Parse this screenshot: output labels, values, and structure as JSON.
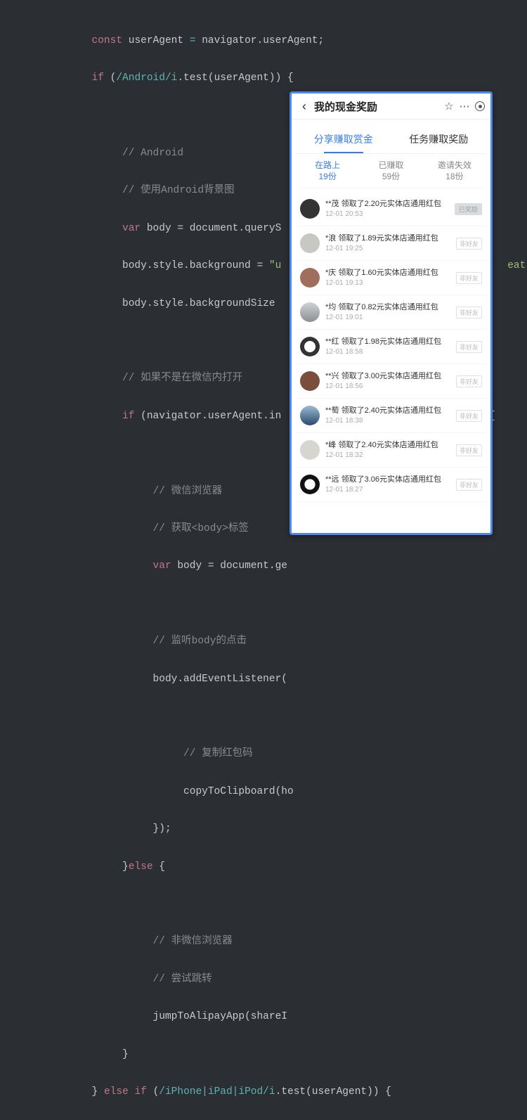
{
  "code": {
    "l1a": "const",
    "l1b": "userAgent",
    "l1c": "=",
    "l1d": "navigator",
    "l1e": ".userAgent;",
    "l2a": "if",
    "l2b": "(",
    "l2c": "/Android/i",
    "l2d": ".test(userAgent)) {",
    "l4": "// Android",
    "l5": "// 使用Android背景图",
    "l6a": "var",
    "l6b": "body = document.queryS",
    "l7a": "body.style.background = ",
    "l7b": "\"u",
    "l7c": "eat\"",
    "l7d": ";",
    "l8": "body.style.backgroundSize",
    "l10": "// 如果不是在微信内打开",
    "l11a": "if",
    "l11b": "(navigator.userAgent.in",
    "l11c": ") {",
    "l13": "// 微信浏览器",
    "l14": "// 获取<body>标签",
    "l15a": "var",
    "l15b": "body = document.ge",
    "l17": "// 监听body的点击",
    "l18": "body.addEventListener(",
    "l20": "// 复制红包码",
    "l21": "copyToClipboard(ho",
    "l22": "});",
    "l23a": "}",
    "l23b": "else",
    "l23c": "{",
    "l25": "// 非微信浏览器",
    "l26": "// 尝试跳转",
    "l27": "jumpToAlipayApp(shareI",
    "l28": "}",
    "l29a": "} ",
    "l29b": "else if",
    "l29c": "(",
    "l29d": "/iPhone|iPad|iPod/i",
    "l29e": ".test(userAgent)) {"
  },
  "phone": {
    "title": "我的现金奖励",
    "tabs": [
      "分享赚取赏金",
      "任务赚取奖励"
    ],
    "stats": [
      {
        "label": "在路上",
        "value": "19份"
      },
      {
        "label": "已赚取",
        "value": "59份"
      },
      {
        "label": "邀请失效",
        "value": "18份"
      }
    ],
    "rows": [
      {
        "name": "**茂 领取了2.20元实体店通用红包",
        "time": "12-01 20:53",
        "badge": "已奖励",
        "badgeStyle": "gray",
        "av": "#333"
      },
      {
        "name": "*浪 领取了1.89元实体店通用红包",
        "time": "12-01 19:25",
        "badge": "非好友",
        "badgeStyle": "",
        "av": "#c8c8c2"
      },
      {
        "name": "*庆 领取了1.60元实体店通用红包",
        "time": "12-01 19:13",
        "badge": "非好友",
        "badgeStyle": "",
        "av": "#a06e5c"
      },
      {
        "name": "*均 领取了0.82元实体店通用红包",
        "time": "12-01 19:01",
        "badge": "非好友",
        "badgeStyle": "",
        "av": "linear-gradient(#cfd3d6,#8b8f92)"
      },
      {
        "name": "**红 领取了1.98元实体店通用红包",
        "time": "12-01 18:58",
        "badge": "非好友",
        "badgeStyle": "",
        "av": "radial-gradient(#fff 40%,#333 41%)"
      },
      {
        "name": "**兴 领取了3.00元实体店通用红包",
        "time": "12-01 18:56",
        "badge": "非好友",
        "badgeStyle": "",
        "av": "#7a4e3a"
      },
      {
        "name": "**萄 领取了2.40元实体店通用红包",
        "time": "12-01 18:38",
        "badge": "非好友",
        "badgeStyle": "",
        "av": "linear-gradient(#9bbad4,#2a4a6a)"
      },
      {
        "name": "*峰 领取了2.40元实体店通用红包",
        "time": "12-01 18:32",
        "badge": "非好友",
        "badgeStyle": "",
        "av": "#d8d4cf"
      },
      {
        "name": "**远 领取了3.06元实体店通用红包",
        "time": "12-01 18:27",
        "badge": "非好友",
        "badgeStyle": "",
        "av": "radial-gradient(#fff 38%,#111 39%)"
      }
    ]
  }
}
